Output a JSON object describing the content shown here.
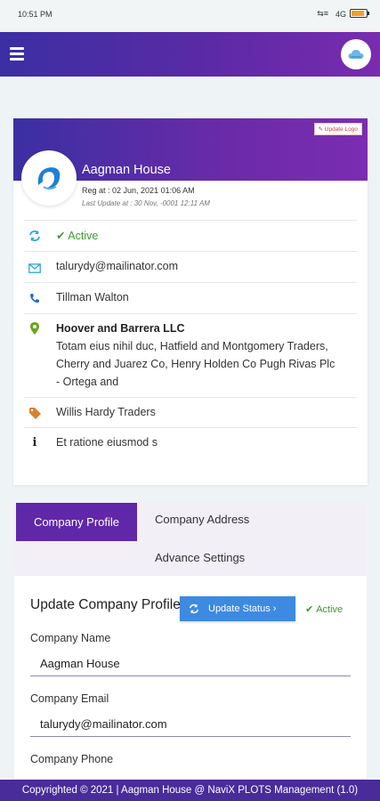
{
  "statusbar": {
    "time": "10:51 PM",
    "signal": "⇆≡",
    "network": "4G",
    "battery_level": 0.85
  },
  "appbar": {
    "menu_icon": "hamburger-icon",
    "avatar_icon": "cloud-icon"
  },
  "company_card": {
    "update_logo_label": "Update Logo",
    "name": "Aagman House",
    "reg": "Reg at : 02 Jun, 2021 01:06 AM",
    "last_update": "Last Update at : 30 Nov, -0001 12:11 AM",
    "status": "Active",
    "email": "talurydy@mailinator.com",
    "phone": "Tillman Walton",
    "address_title": "Hoover and Barrera LLC",
    "address_line1": "Totam eius nihil duc, Hatfield and Montgomery Traders,",
    "address_line2": "Cherry and Juarez Co, Henry Holden Co Pugh Rivas Plc",
    "address_line3": "- Ortega and",
    "tag": "Willis Hardy Traders",
    "info": "Et ratione eiusmod s"
  },
  "tabs": [
    {
      "label": "Company Profile"
    },
    {
      "label": "Company Address"
    },
    {
      "label": "Advance Settings"
    }
  ],
  "form": {
    "title": "Update Company Profile",
    "update_status_label": "Update Status ›",
    "status_badge": "Active",
    "company_name_label": "Company Name",
    "company_name_value": "Aagman House",
    "company_email_label": "Company Email",
    "company_email_value": "talurydy@mailinator.com",
    "company_phone_label": "Company Phone"
  },
  "footer": {
    "text": "Copyrighted © 2021 | Aagman House @ NaviX PLOTS Management (1.0)"
  },
  "colors": {
    "primary": "#5b2aa6",
    "accent_blue": "#3d8ae0",
    "active_green": "#3d9a2f",
    "footer": "#4a2b9a"
  }
}
